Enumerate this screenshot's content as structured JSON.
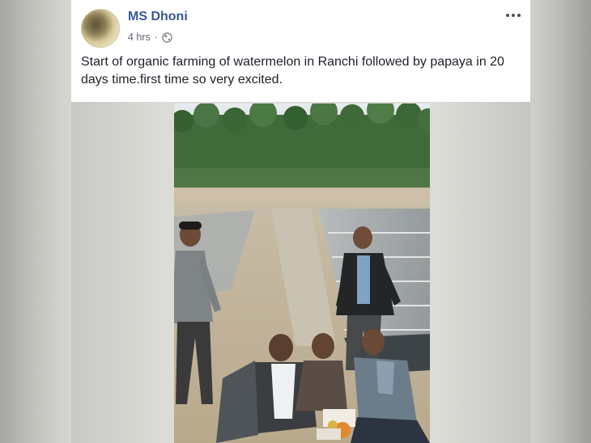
{
  "post": {
    "author": "MS Dhoni",
    "time": "4 hrs",
    "separator": "·",
    "text": "Start of organic farming of watermelon in Ranchi followed by papaya in 20 days time.first time so very excited.",
    "privacy_icon": "globe-icon",
    "more_icon": "more-options-icon"
  },
  "media": {
    "type": "video-frame",
    "scene": "farm-field-ceremony"
  },
  "colors": {
    "author_link": "#365899",
    "meta_text": "#616770",
    "body_text": "#1d2129"
  }
}
